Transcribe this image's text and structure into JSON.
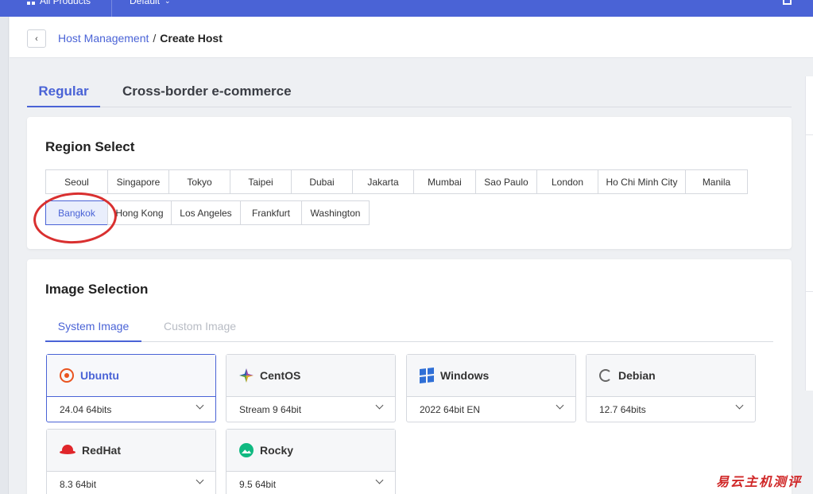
{
  "topbar": {
    "all_products": "All Products",
    "project": "Default"
  },
  "breadcrumb": {
    "parent": "Host Management",
    "separator": "/",
    "current": "Create Host"
  },
  "main_tabs": [
    {
      "label": "Regular",
      "active": true
    },
    {
      "label": "Cross-border e-commerce",
      "active": false
    }
  ],
  "region": {
    "title": "Region Select",
    "rows": [
      [
        "Seoul",
        "Singapore",
        "Tokyo",
        "Taipei",
        "Dubai",
        "Jakarta",
        "Mumbai",
        "Sao Paulo",
        "London",
        "Ho Chi Minh City",
        "Manila"
      ],
      [
        "Bangkok",
        "Hong Kong",
        "Los Angeles",
        "Frankfurt",
        "Washington"
      ]
    ],
    "selected": "Bangkok"
  },
  "image": {
    "title": "Image Selection",
    "tabs": [
      {
        "label": "System Image",
        "active": true
      },
      {
        "label": "Custom Image",
        "active": false
      }
    ],
    "os": [
      {
        "name": "Ubuntu",
        "version": "24.04 64bits",
        "icon": "ubuntu-icon",
        "selected": true
      },
      {
        "name": "CentOS",
        "version": "Stream 9 64bit",
        "icon": "centos-icon",
        "selected": false
      },
      {
        "name": "Windows",
        "version": "2022 64bit EN",
        "icon": "windows-icon",
        "selected": false
      },
      {
        "name": "Debian",
        "version": "12.7 64bits",
        "icon": "debian-icon",
        "selected": false
      },
      {
        "name": "RedHat",
        "version": "8.3 64bit",
        "icon": "redhat-icon",
        "selected": false
      },
      {
        "name": "Rocky",
        "version": "9.5 64bit",
        "icon": "rocky-icon",
        "selected": false
      }
    ]
  },
  "watermark": "易云主机测评",
  "colors": {
    "primary": "#4a63d6",
    "annotation": "#d93030"
  }
}
